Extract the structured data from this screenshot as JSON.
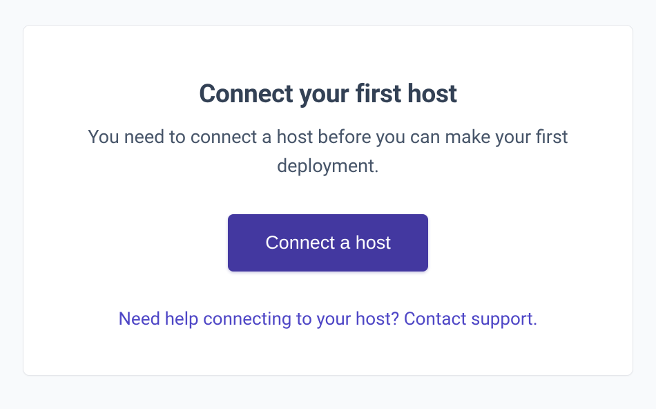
{
  "card": {
    "title": "Connect your first host",
    "subtitle": "You need to connect a host before you can make your first deployment.",
    "cta_label": "Connect a host",
    "help_text": "Need help connecting to your host? Contact support."
  }
}
